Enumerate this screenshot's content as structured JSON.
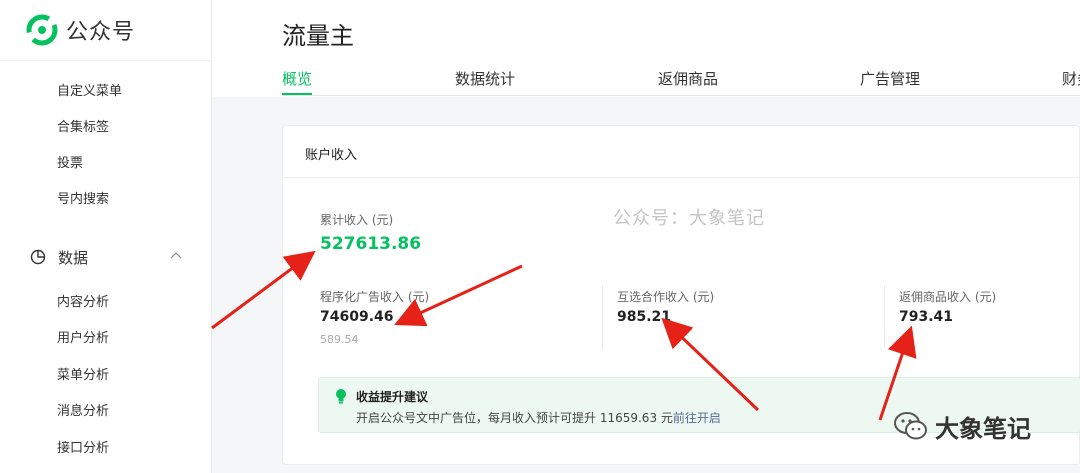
{
  "brand": {
    "name": "公众号"
  },
  "sidebar": {
    "items_top": [
      {
        "label": "自定义菜单"
      },
      {
        "label": "合集标签"
      },
      {
        "label": "投票"
      },
      {
        "label": "号内搜索"
      }
    ],
    "section": {
      "label": "数据",
      "icon": "pie-chart-icon"
    },
    "items_data": [
      {
        "label": "内容分析"
      },
      {
        "label": "用户分析"
      },
      {
        "label": "菜单分析"
      },
      {
        "label": "消息分析"
      },
      {
        "label": "接口分析"
      }
    ]
  },
  "header": {
    "title": "流量主",
    "tabs": [
      {
        "label": "概览",
        "active": true
      },
      {
        "label": "数据统计"
      },
      {
        "label": "返佣商品"
      },
      {
        "label": "广告管理"
      },
      {
        "label": "财务"
      }
    ]
  },
  "card": {
    "title": "账户收入",
    "watermark": "公众号：大象笔记",
    "total": {
      "label": "累计收入 (元)",
      "value": "527613.86"
    },
    "stats": [
      {
        "label": "程序化广告收入 (元)",
        "value": "74609.46",
        "sub": "589.54"
      },
      {
        "label": "互选合作收入 (元)",
        "value": "985.21"
      },
      {
        "label": "返佣商品收入 (元)",
        "value": "793.41"
      }
    ],
    "tip": {
      "title": "收益提升建议",
      "desc": "开启公众号文中广告位，每月收入预计可提升 11659.63 元",
      "link": "前往开启"
    }
  },
  "corner_watermark": {
    "text": "大象笔记"
  },
  "colors": {
    "accent": "#07c160",
    "link": "#576b95",
    "arrow": "#e62117"
  }
}
